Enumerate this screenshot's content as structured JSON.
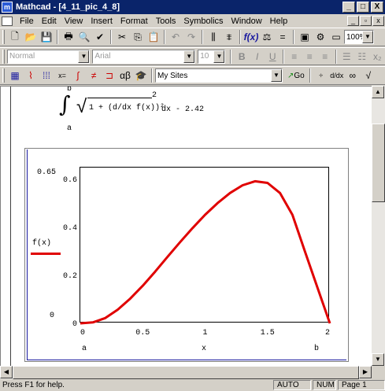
{
  "window": {
    "title": "Mathcad - [4_11_pic_4_8]",
    "minimize": "_",
    "maximize": "□",
    "close": "X"
  },
  "menu": {
    "items": [
      "File",
      "Edit",
      "View",
      "Insert",
      "Format",
      "Tools",
      "Symbolics",
      "Window",
      "Help"
    ]
  },
  "toolbar": {
    "zoom_value": "100%"
  },
  "format_bar": {
    "style_value": "Normal",
    "font_value": "Arial",
    "size_value": "10",
    "bold": "B",
    "italic": "I",
    "underline": "U"
  },
  "resource_bar": {
    "resource_value": "My Sites",
    "go_label": "Go"
  },
  "worksheet": {
    "equation_upper_limit": "b",
    "equation_lower_limit": "a",
    "equation_integrand": "1 + (d/dx f(x))²",
    "equation_tail": "dx - 2.42",
    "integral_sign": "∫",
    "sqrt_sign": "√",
    "exponent": "2"
  },
  "chart_data": {
    "type": "line",
    "ylabel": "f(x)",
    "xlabel": "x",
    "x_axis_left_label": "a",
    "x_axis_right_label": "b",
    "y_bottom_label": "0",
    "y_top_label": "0.65",
    "xlim": [
      0,
      2
    ],
    "ylim": [
      0,
      0.65
    ],
    "x_ticks": [
      "0",
      "0.5",
      "1",
      "1.5",
      "2"
    ],
    "y_ticks": [
      "0.6",
      "0.4",
      "0.2",
      "0"
    ],
    "series": [
      {
        "color": "#e00000",
        "x": [
          0,
          0.1,
          0.2,
          0.3,
          0.4,
          0.5,
          0.6,
          0.7,
          0.8,
          0.9,
          1.0,
          1.1,
          1.2,
          1.3,
          1.4,
          1.5,
          1.6,
          1.7,
          1.8,
          1.9,
          2.0
        ],
        "y": [
          0,
          0.004,
          0.022,
          0.057,
          0.103,
          0.157,
          0.216,
          0.278,
          0.339,
          0.398,
          0.453,
          0.502,
          0.544,
          0.576,
          0.593,
          0.586,
          0.544,
          0.453,
          0.3,
          0.15,
          0
        ]
      }
    ]
  },
  "status": {
    "help": "Press F1 for help.",
    "mode": "AUTO",
    "num": "NUM",
    "page": "Page 1"
  },
  "colors": {
    "titlebar": "#0a246a",
    "curve": "#e00000",
    "frame_border": "#1a1aa0"
  }
}
